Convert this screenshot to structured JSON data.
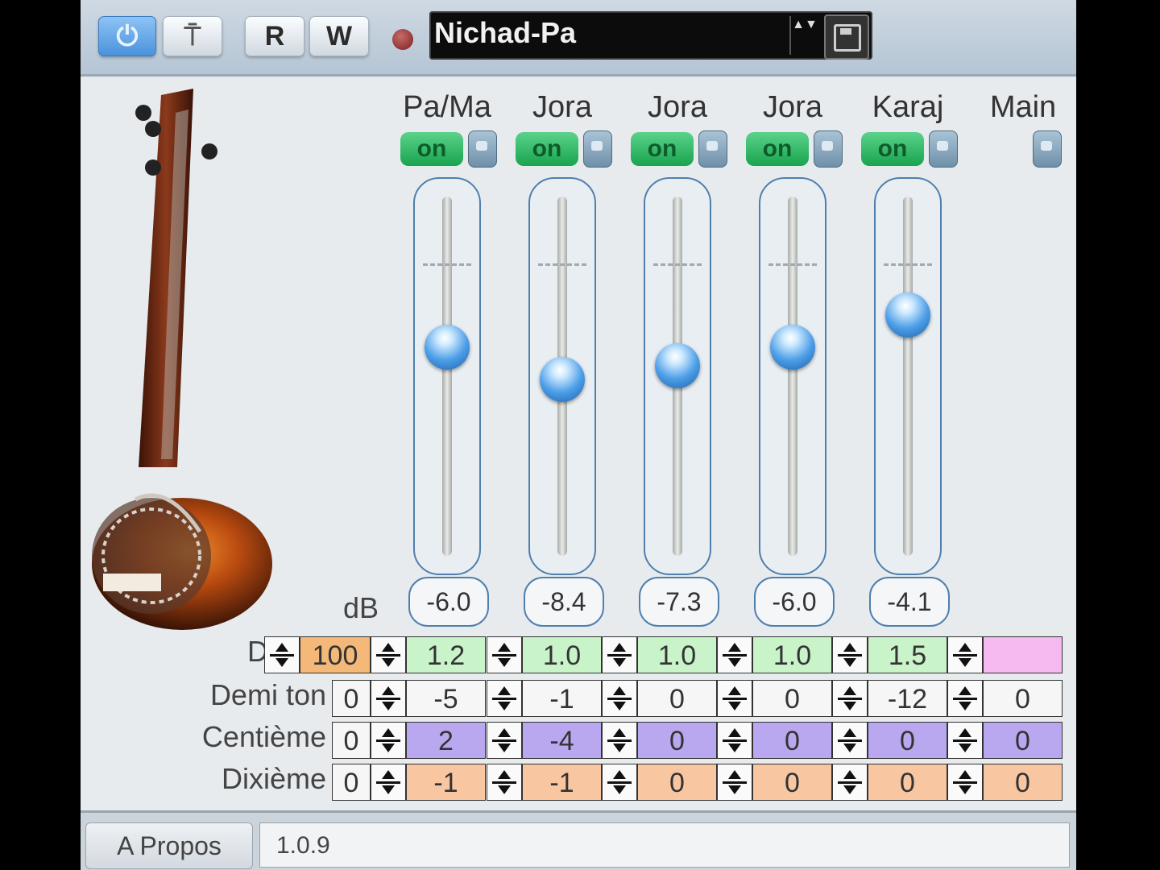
{
  "toolbar": {
    "power_label": "⏻",
    "bypass_label": "⍑",
    "read_label": "R",
    "write_label": "W",
    "preset_name": "Nichad-Pa",
    "preset_step": "▲▼"
  },
  "channels": [
    {
      "label": "Pa/Ma",
      "on": "on",
      "db": "-6.0",
      "level": 0.58
    },
    {
      "label": "Jora",
      "on": "on",
      "db": "-8.4",
      "level": 0.49
    },
    {
      "label": "Jora",
      "on": "on",
      "db": "-7.3",
      "level": 0.53
    },
    {
      "label": "Jora",
      "on": "on",
      "db": "-6.0",
      "level": 0.58
    },
    {
      "label": "Karaj",
      "on": "on",
      "db": "-4.1",
      "level": 0.67
    },
    {
      "label": "Main"
    }
  ],
  "db_unit": "dB",
  "rows": {
    "duree": {
      "label": "Durée",
      "first": "100",
      "values": [
        "1.2",
        "1.0",
        "1.0",
        "1.0",
        "1.5",
        ""
      ]
    },
    "demiton": {
      "label": "Demi ton",
      "first": "0",
      "values": [
        "-5",
        "-1",
        "0",
        "0",
        "-12",
        "0"
      ]
    },
    "centieme": {
      "label": "Centième",
      "first": "0",
      "values": [
        "2",
        "-4",
        "0",
        "0",
        "0",
        "0"
      ]
    },
    "dixieme": {
      "label": "Dixième",
      "first": "0",
      "values": [
        "-1",
        "-1",
        "0",
        "0",
        "0",
        "0"
      ]
    }
  },
  "footer": {
    "about_label": "A Propos",
    "version": "1.0.9"
  },
  "colors": {
    "accent_blue": "#4a92db",
    "on_green": "#18a44f",
    "duree_first": "#f4b978",
    "duree_cells": "#c9f3c9",
    "duree_main": "#f6b9f0",
    "centieme_cells": "#b9a8ef",
    "dixieme_cells": "#f9c6a2"
  }
}
